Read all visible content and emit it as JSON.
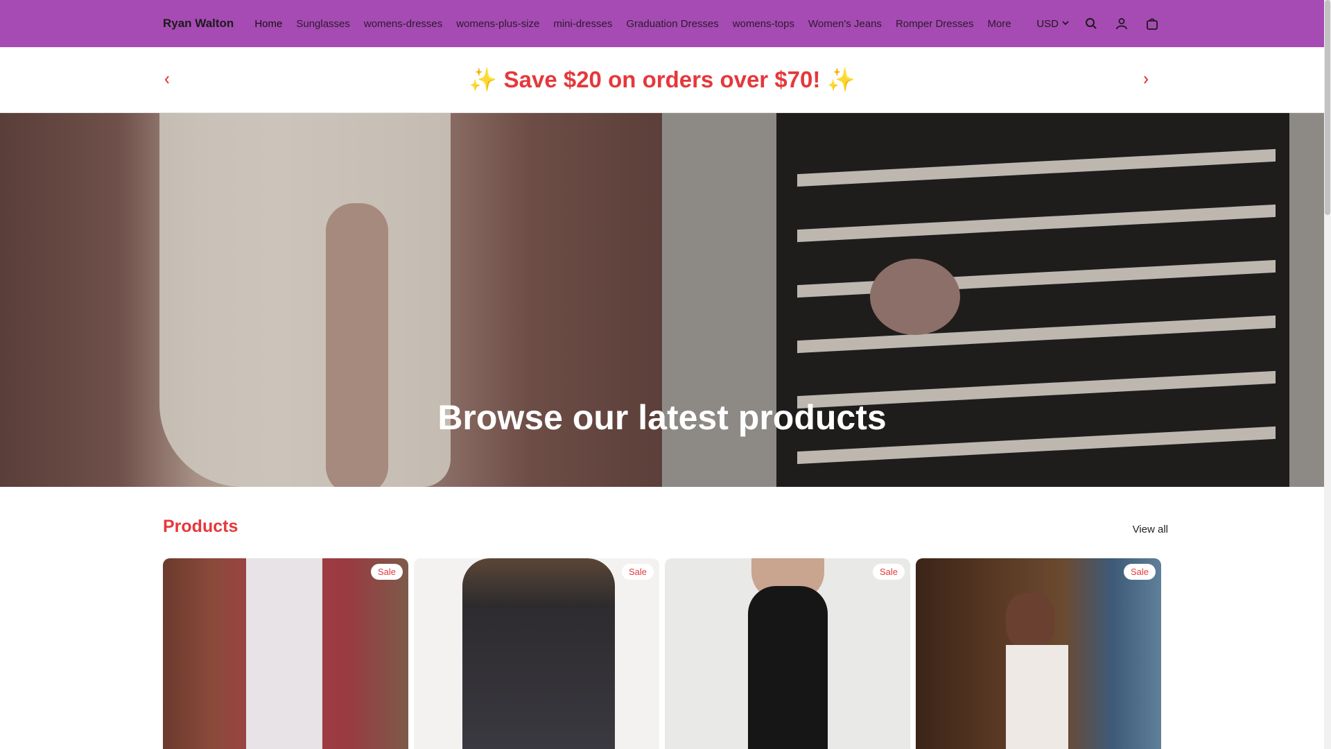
{
  "header": {
    "brand": "Ryan Walton",
    "nav": [
      {
        "label": "Home"
      },
      {
        "label": "Sunglasses"
      },
      {
        "label": "womens-dresses"
      },
      {
        "label": "womens-plus-size"
      },
      {
        "label": "mini-dresses"
      },
      {
        "label": "Graduation Dresses"
      },
      {
        "label": "womens-tops"
      },
      {
        "label": "Women's Jeans"
      },
      {
        "label": "Romper Dresses"
      },
      {
        "label": "More"
      }
    ],
    "currency": "USD",
    "icons": [
      "search-icon",
      "account-icon",
      "cart-icon"
    ],
    "background_color": "#a64bb3"
  },
  "announcement": {
    "text": "✨ Save $20 on orders over $70! ✨",
    "color": "#e5383b"
  },
  "hero": {
    "title": "Browse our latest products"
  },
  "products": {
    "title": "Products",
    "view_all": "View all",
    "items": [
      {
        "badge": "Sale"
      },
      {
        "badge": "Sale"
      },
      {
        "badge": "Sale"
      },
      {
        "badge": "Sale"
      }
    ]
  }
}
